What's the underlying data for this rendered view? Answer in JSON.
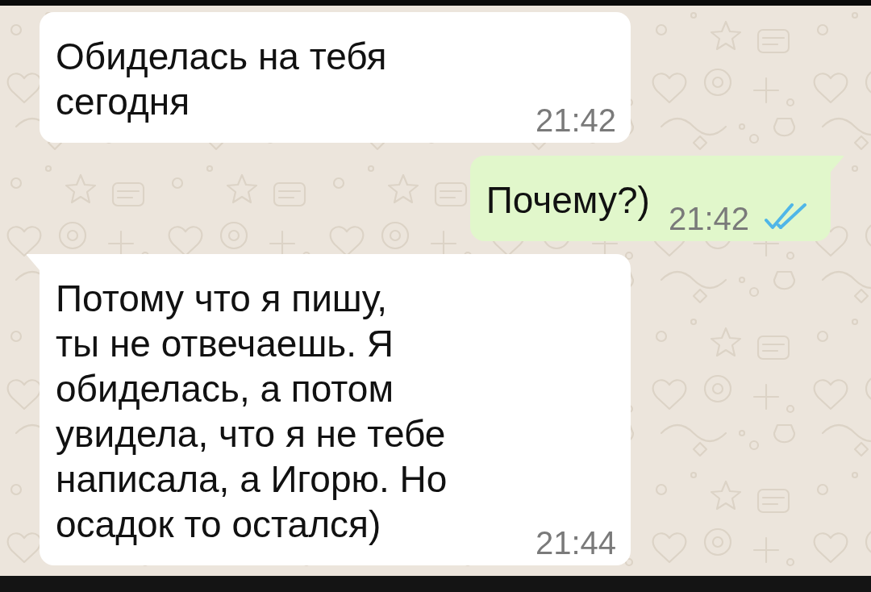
{
  "messages": [
    {
      "kind": "incoming",
      "tail": false,
      "text": "Обиделась на тебя\nсегодня",
      "time": "21:42"
    },
    {
      "kind": "outgoing",
      "tail": true,
      "text": "Почему?)",
      "time": "21:42",
      "read": true
    },
    {
      "kind": "incoming",
      "tail": true,
      "text": "Потому что я пишу,\nты не отвечаешь. Я\nобиделась, а потом\nувидела, что я не тебе\nнаписала, а Игорю. Но\nосадок то остался)",
      "time": "21:44"
    }
  ]
}
